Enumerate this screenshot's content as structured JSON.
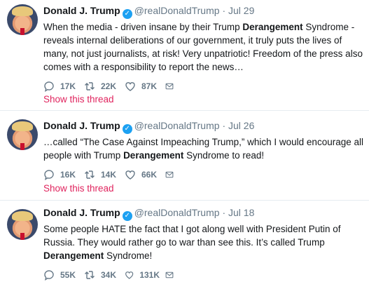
{
  "tweets": [
    {
      "name": "Donald J. Trump",
      "handle": "@realDonaldTrump",
      "dot": "·",
      "date": "Jul 29",
      "text_parts": [
        "When the media - driven insane by their Trump ",
        "Derangement",
        " Syndrome - reveals internal deliberations of our government, it  truly puts the lives of many, not just journalists, at risk! Very unpatriotic! Freedom of the press also comes with a responsibility to report the news…"
      ],
      "replies": "17K",
      "retweets": "22K",
      "likes": "87K",
      "thread_label": "Show this thread"
    },
    {
      "name": "Donald J. Trump",
      "handle": "@realDonaldTrump",
      "dot": "·",
      "date": "Jul 26",
      "text_parts": [
        "…called “The Case Against Impeaching Trump,” which I would encourage all people with Trump ",
        "Derangement",
        " Syndrome to read!"
      ],
      "replies": "16K",
      "retweets": "14K",
      "likes": "66K",
      "thread_label": "Show this thread"
    },
    {
      "name": "Donald J. Trump",
      "handle": "@realDonaldTrump",
      "dot": "·",
      "date": "Jul 18",
      "text_parts": [
        "Some people HATE the fact that I got along well with President Putin of Russia. They would rather go to war than see this. It’s called Trump ",
        "Derangement",
        " Syndrome!"
      ],
      "replies": "55K",
      "retweets": "34K",
      "likes": "131K"
    }
  ],
  "icons": {
    "reply": "reply-icon",
    "retweet": "retweet-icon",
    "like": "heart-icon",
    "message": "envelope-icon",
    "verified": "verified-badge-icon"
  },
  "colors": {
    "thread_link": "#e0245e",
    "verified": "#1da1f2",
    "muted": "#657786"
  }
}
